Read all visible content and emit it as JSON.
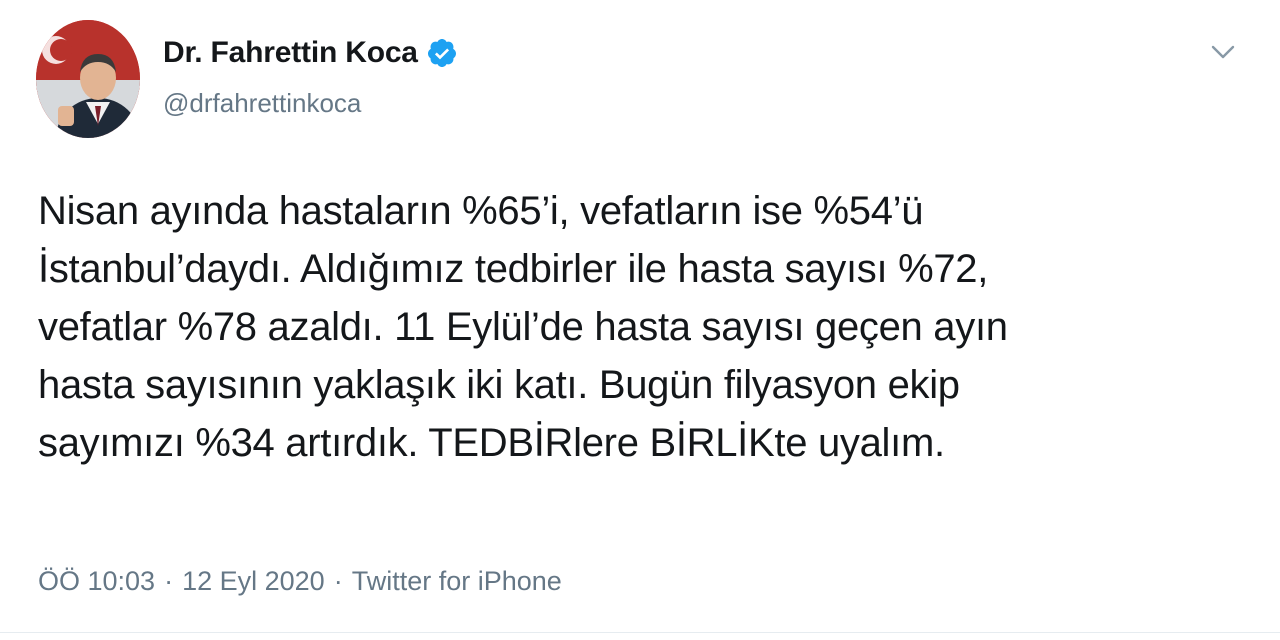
{
  "author": {
    "name": "Dr. Fahrettin Koca",
    "handle": "@drfahrettinkoca",
    "verified": true,
    "verified_icon": "verified-badge-icon",
    "accent_color": "#1da1f2"
  },
  "tweet": {
    "lines": [
      "Nisan ayında hastaların %65’i, vefatların ise %54’ü",
      "İstanbul’daydı. Aldığımız tedbirler ile hasta sayısı %72,",
      "vefatlar %78 azaldı. 11 Eylül’de hasta sayısı geçen ayın",
      "hasta sayısının yaklaşık iki katı. Bugün filyasyon ekip",
      "sayımızı %34 artırdık. TEDBİRlere BİRLİKte uyalım."
    ]
  },
  "meta": {
    "time": "ÖÖ 10:03",
    "separator": "·",
    "date": "12 Eyl 2020",
    "source": "Twitter for iPhone"
  },
  "menu": {
    "icon": "chevron-down-icon"
  },
  "colors": {
    "text": "#14171a",
    "secondary": "#657786"
  }
}
